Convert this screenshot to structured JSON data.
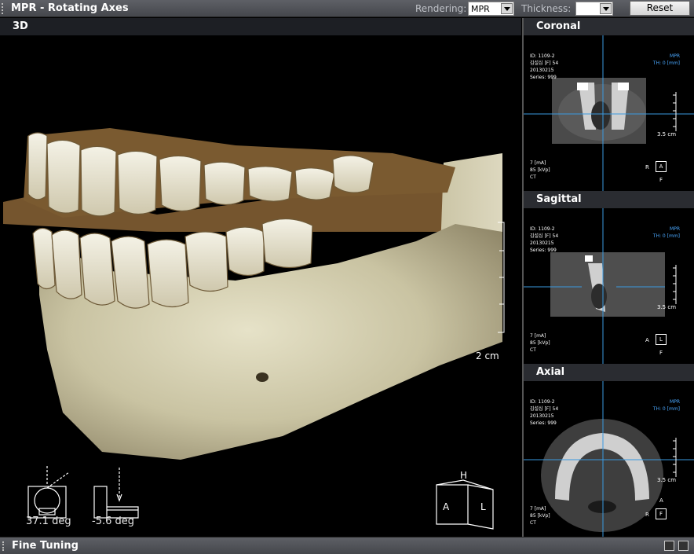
{
  "app": {
    "title": "MPR - Rotating Axes"
  },
  "toolbar": {
    "rendering_label": "Rendering:",
    "rendering_value": "MPR",
    "thickness_label": "Thickness:",
    "thickness_value": "",
    "reset_label": "Reset"
  },
  "view3d": {
    "title": "3D",
    "scale_label": "2 cm",
    "rotation_1": "37.1 deg",
    "rotation_2": "-5.6 deg",
    "orientation": {
      "top": "H",
      "left": "A",
      "right": "L"
    }
  },
  "mpr_panes": [
    {
      "title": "Coronal",
      "info_lines": [
        "ID: 1109-2",
        "김설심 [F] 54",
        "20130215",
        "Series: 999"
      ],
      "mode": "MPR",
      "thickness": "TH: 0 [mm]",
      "exposure_lines": [
        "7 [mA]",
        "85 [kVp]",
        "CT"
      ],
      "scale": "3.5 cm",
      "orient_left": "R",
      "orient_box": "A",
      "orient_bottom": "F"
    },
    {
      "title": "Sagittal",
      "info_lines": [
        "ID: 1109-2",
        "김설심 [F] 54",
        "20130215",
        "Series: 999"
      ],
      "mode": "MPR",
      "thickness": "TH: 0 [mm]",
      "exposure_lines": [
        "7 [mA]",
        "85 [kVp]",
        "CT"
      ],
      "scale": "3.5 cm",
      "orient_left": "A",
      "orient_box": "L",
      "orient_bottom": "F"
    },
    {
      "title": "Axial",
      "info_lines": [
        "ID: 1109-2",
        "김설심 [F] 54",
        "20130215",
        "Series: 999"
      ],
      "mode": "MPR",
      "thickness": "TH: 0 [mm]",
      "exposure_lines": [
        "7 [mA]",
        "85 [kVp]",
        "CT"
      ],
      "scale": "3.5 cm",
      "orient_left": "R",
      "orient_box": "F",
      "orient_top": "A"
    }
  ],
  "footer": {
    "label": "Fine Tuning"
  }
}
